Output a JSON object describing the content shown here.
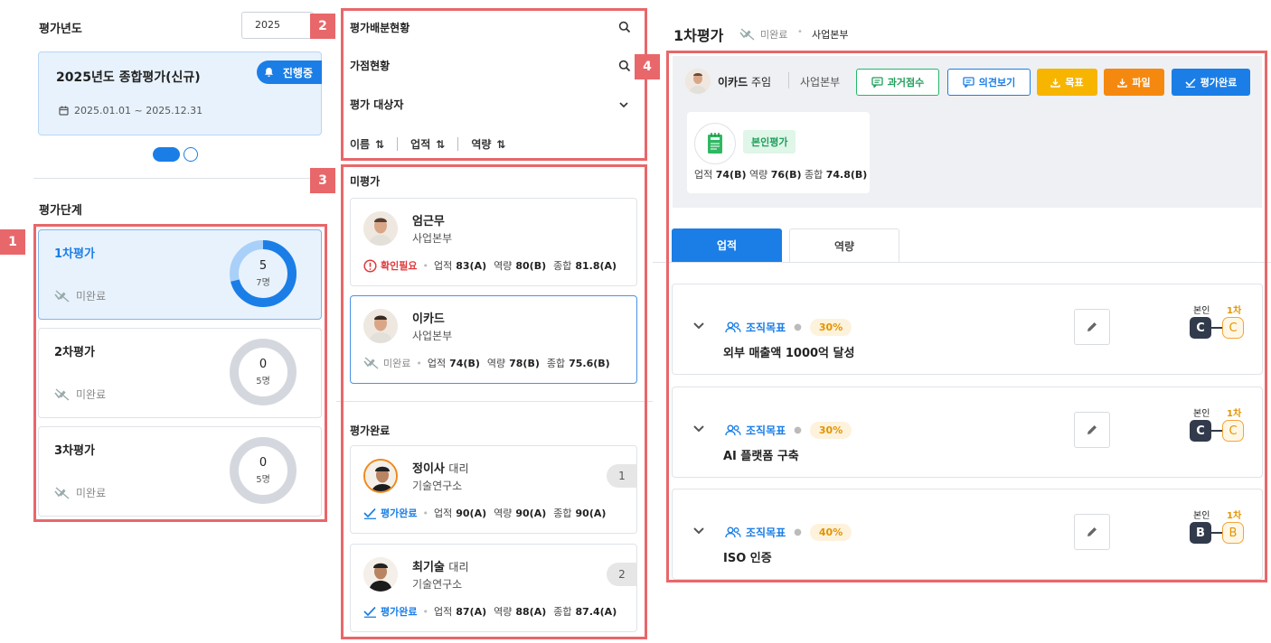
{
  "left": {
    "year_label": "평가년도",
    "year_value": "2025",
    "plan": {
      "title": "2025년도 종합평가(신규)",
      "badge": "진행중",
      "period": "2025.01.01 ~ 2025.12.31"
    },
    "stage_label": "평가단계",
    "stages": [
      {
        "title": "1차평가",
        "status": "미완료",
        "done": "5",
        "total": "7명",
        "ratio": 0.71
      },
      {
        "title": "2차평가",
        "status": "미완료",
        "done": "0",
        "total": "5명",
        "ratio": 0
      },
      {
        "title": "3차평가",
        "status": "미완료",
        "done": "0",
        "total": "5명",
        "ratio": 0
      }
    ]
  },
  "middle": {
    "rows": [
      "평가배분현황",
      "가점현황",
      "평가 대상자"
    ],
    "sort": [
      "이름",
      "업적",
      "역량"
    ],
    "pending_label": "미평가",
    "done_label": "평가완료",
    "pending": [
      {
        "name": "엄근무",
        "rank": "",
        "dept": "사업본부",
        "status": "확인필요",
        "s1": "업적",
        "v1": "83(A)",
        "s2": "역량",
        "v2": "80(B)",
        "s3": "종합",
        "v3": "81.8(A)"
      },
      {
        "name": "이카드",
        "rank": "",
        "dept": "사업본부",
        "status": "미완료",
        "s1": "업적",
        "v1": "74(B)",
        "s2": "역량",
        "v2": "78(B)",
        "s3": "종합",
        "v3": "75.6(B)"
      }
    ],
    "done": [
      {
        "name": "정이사",
        "rank": "대리",
        "dept": "기술연구소",
        "status": "평가완료",
        "s1": "업적",
        "v1": "90(A)",
        "s2": "역량",
        "v2": "90(A)",
        "s3": "종합",
        "v3": "90(A)",
        "order": "1"
      },
      {
        "name": "최기술",
        "rank": "대리",
        "dept": "기술연구소",
        "status": "평가완료",
        "s1": "업적",
        "v1": "87(A)",
        "s2": "역량",
        "v2": "88(A)",
        "s3": "종합",
        "v3": "87.4(A)",
        "order": "2"
      }
    ]
  },
  "right": {
    "title": "1차평가",
    "status": "미완료",
    "dept": "사업본부",
    "header": {
      "name": "이카드",
      "rank": "주임",
      "dept": "사업본부",
      "buttons": [
        "과거점수",
        "의견보기",
        "목표",
        "파일",
        "평가완료"
      ]
    },
    "self_eval": {
      "tag": "본인평가",
      "l1": "업적",
      "v1": "74(B)",
      "l2": "역량",
      "v2": "76(B)",
      "l3": "종합",
      "v3": "74.8(B)"
    },
    "tabs": [
      "업적",
      "역량"
    ],
    "grade_labels": [
      "본인",
      "1차"
    ],
    "goals": [
      {
        "type": "조직목표",
        "weight": "30%",
        "title": "외부 매출액 1000억 달성",
        "g1": "C",
        "g2": "C"
      },
      {
        "type": "조직목표",
        "weight": "30%",
        "title": "AI 플랫폼 구축",
        "g1": "C",
        "g2": "C"
      },
      {
        "type": "조직목표",
        "weight": "40%",
        "title": "ISO 인증",
        "g1": "B",
        "g2": "B"
      }
    ]
  },
  "markers": [
    "1",
    "2",
    "3",
    "4"
  ],
  "colors": {
    "accent": "#1b7ee6",
    "marker": "#e8676a",
    "warning": "#e2383c",
    "amber": "#e39400",
    "green": "#1f9e5b"
  }
}
